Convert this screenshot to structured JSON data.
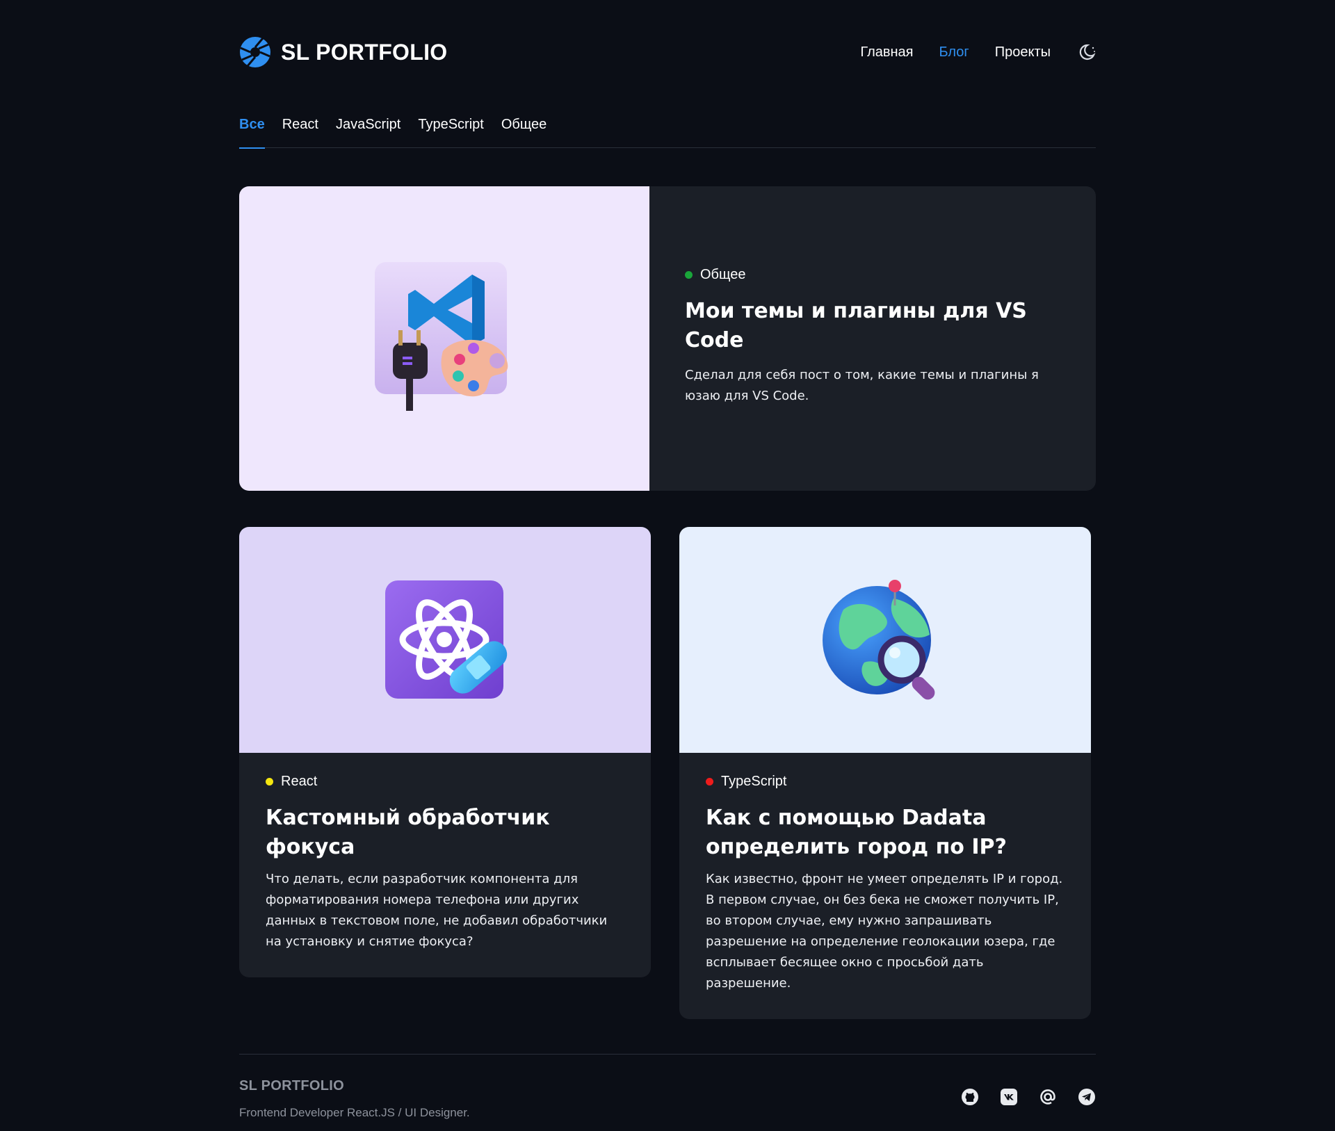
{
  "header": {
    "logo_text": "SL PORTFOLIO",
    "nav": [
      {
        "label": "Главная"
      },
      {
        "label": "Блог"
      },
      {
        "label": "Проекты"
      }
    ]
  },
  "tabs": [
    {
      "label": "Все"
    },
    {
      "label": "React"
    },
    {
      "label": "JavaScript"
    },
    {
      "label": "TypeScript"
    },
    {
      "label": "Общее"
    }
  ],
  "featured": {
    "tag": "Общее",
    "tag_color": "#1aa53a",
    "title": "Мои темы и плагины для VS Code",
    "description": "Сделал для себя пост о том, какие темы и плагины я юзаю для VS Code."
  },
  "posts": [
    {
      "tag": "React",
      "tag_color": "#f4e610",
      "title": "Кастомный обработчик фокуса",
      "description": "Что делать, если разработчик компонента для форматирования номера телефона или других данных в текстовом поле, не добавил обработчики на установку и снятие фокуса?"
    },
    {
      "tag": "TypeScript",
      "tag_color": "#ee1c1c",
      "title": "Как с помощью Dadata определить город по IP?",
      "description": "Как известно, фронт не умеет определять IP и город. В первом случае, он без бека не сможет получить IP, во втором случае, ему нужно запрашивать разрешение на определение геолокации юзера, где всплывает бесящее окно с просьбой дать разрешение."
    }
  ],
  "footer": {
    "brand": "SL PORTFOLIO",
    "subtitle": "Frontend Developer React.JS / UI Designer."
  },
  "colors": {
    "accent": "#2f8ff0",
    "background": "#0b0e16",
    "card": "#1b1f27"
  }
}
